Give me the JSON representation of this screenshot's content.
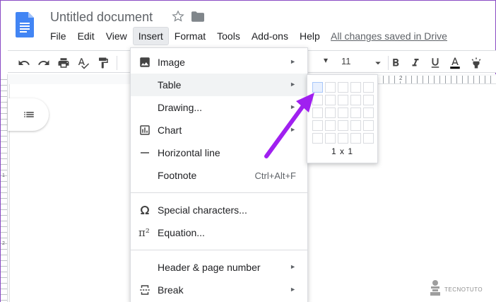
{
  "document": {
    "title": "Untitled document",
    "save_status": "All changes saved in Drive"
  },
  "menubar": {
    "items": [
      {
        "label": "File"
      },
      {
        "label": "Edit"
      },
      {
        "label": "View"
      },
      {
        "label": "Insert",
        "active": true
      },
      {
        "label": "Format"
      },
      {
        "label": "Tools"
      },
      {
        "label": "Add-ons"
      },
      {
        "label": "Help"
      }
    ]
  },
  "toolbar": {
    "font_size": "11"
  },
  "ruler": {
    "v_mark_1": "1",
    "v_mark_2": "2",
    "h_mark": "2"
  },
  "insert_menu": {
    "items": [
      {
        "label": "Image",
        "icon": "image-icon",
        "submenu": true
      },
      {
        "label": "Table",
        "icon": "",
        "submenu": true,
        "hover": true
      },
      {
        "label": "Drawing...",
        "icon": "",
        "submenu": true
      },
      {
        "label": "Chart",
        "icon": "chart-icon",
        "submenu": true
      },
      {
        "label": "Horizontal line",
        "icon": "horizontal-line-icon",
        "submenu": false
      },
      {
        "label": "Footnote",
        "icon": "",
        "shortcut": "Ctrl+Alt+F"
      },
      {
        "label": "Special characters...",
        "icon": "omega-icon"
      },
      {
        "label": "Equation...",
        "icon": "pi-icon",
        "icon_text": "π²"
      },
      {
        "label": "Header & page number",
        "icon": "",
        "submenu": true
      },
      {
        "label": "Break",
        "icon": "page-break-icon",
        "submenu": true
      }
    ],
    "arrow_glyph": "►"
  },
  "table_grid": {
    "rows": 5,
    "cols": 5,
    "selected_rows": 1,
    "selected_cols": 1,
    "label": "1 x 1"
  },
  "annotation": {
    "arrow_color": "#a020f0"
  },
  "watermark": {
    "text": "TECNOTUTO"
  },
  "colors": {
    "docs_blue": "#4285f4",
    "menu_hover": "#f1f3f4",
    "grid_selected": "#e8f0fe"
  }
}
